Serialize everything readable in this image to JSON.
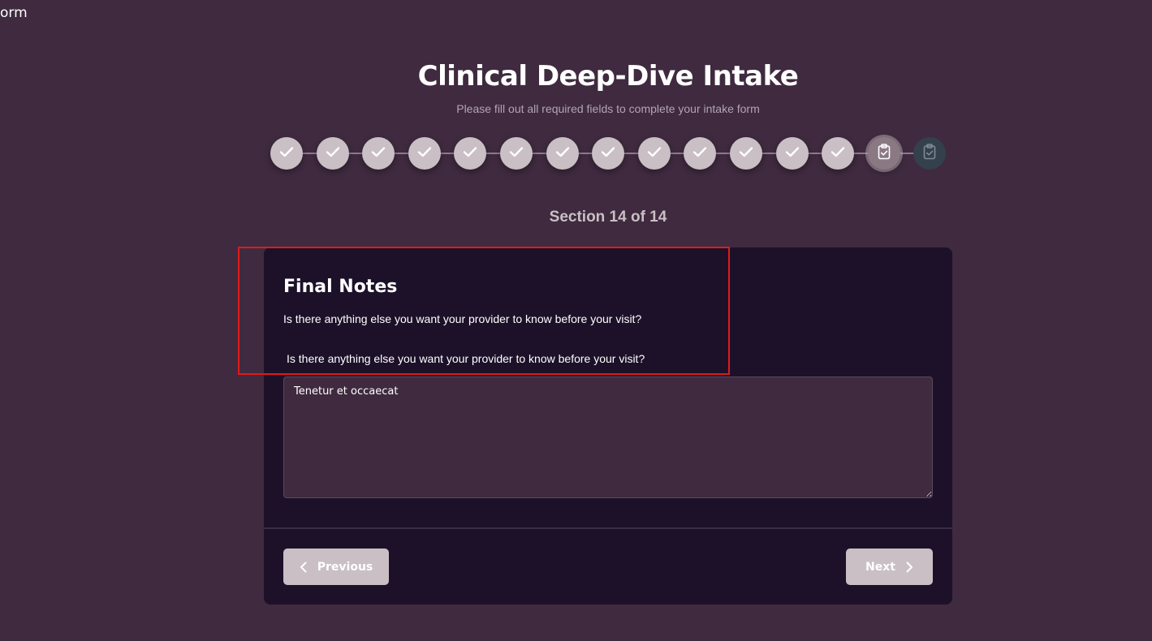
{
  "app": {
    "label": "orm"
  },
  "header": {
    "title": "Clinical Deep-Dive Intake",
    "subtitle": "Please fill out all required fields to complete your intake form"
  },
  "stepper": {
    "total_steps": 14,
    "completed_steps": 13,
    "current_step": 14,
    "completed_icon": "check-icon",
    "current_icon": "clipboard-check-icon",
    "colors": {
      "completed": "#c9bfc4",
      "current": "#8a7983",
      "upcoming": "#34404c"
    }
  },
  "section_counter": "Section 14 of 14",
  "section": {
    "title": "Final Notes",
    "description": "Is there anything else you want your provider to know before your visit?",
    "field": {
      "label": "Is there anything else you want your provider to know before your visit?",
      "value": "Tenetur et occaecat"
    }
  },
  "navigation": {
    "previous_label": "Previous",
    "next_label": "Next",
    "previous_icon": "chevron-left-icon",
    "next_icon": "chevron-right-icon"
  },
  "colors": {
    "page_background": "#3f2a3f",
    "card_background": "#1c1129",
    "button_background": "#c9bfc4",
    "highlight": "#e01a1a"
  }
}
